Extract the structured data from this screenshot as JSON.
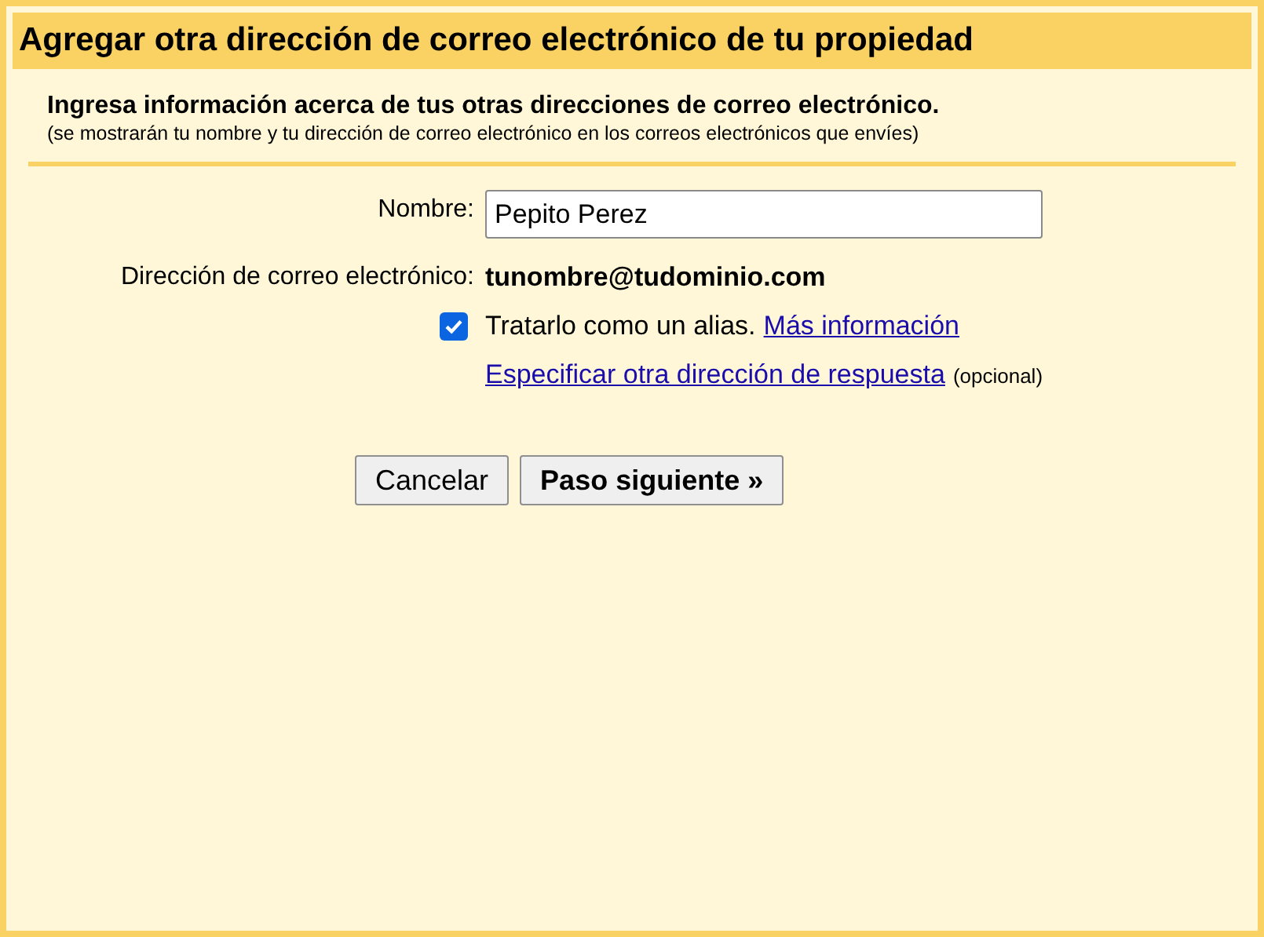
{
  "dialog": {
    "title": "Agregar otra dirección de correo electrónico de tu propiedad",
    "heading": "Ingresa información acerca de tus otras direcciones de correo electrónico.",
    "subheading": "(se mostrarán tu nombre y tu dirección de correo electrónico en los correos electrónicos que envíes)"
  },
  "form": {
    "name_label": "Nombre:",
    "name_value": "Pepito Perez",
    "email_label": "Dirección de correo electrónico:",
    "email_value": "tunombre@tudominio.com",
    "alias": {
      "label": "Tratarlo como un alias.",
      "checked": true,
      "link": "Más información"
    },
    "reply_link": "Especificar otra dirección de respuesta",
    "reply_note": "(opcional)"
  },
  "buttons": [
    {
      "label": "Cancelar",
      "kind": "secondary"
    },
    {
      "label": "Paso siguiente »",
      "kind": "primary"
    }
  ]
}
